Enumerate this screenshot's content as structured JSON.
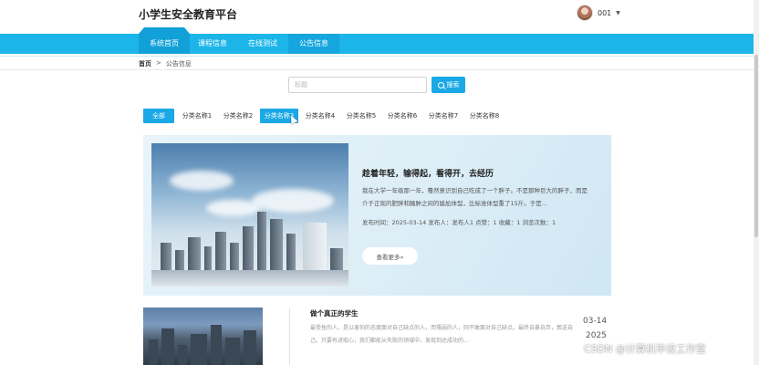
{
  "header": {
    "site_title": "小学生安全教育平台",
    "username": "001",
    "avatar_icon": "user-avatar",
    "caret_icon": "caret-down-icon"
  },
  "nav": {
    "items": [
      {
        "label": "系统首页",
        "state": "active"
      },
      {
        "label": "课程信息",
        "state": "normal"
      },
      {
        "label": "在线测试",
        "state": "normal"
      },
      {
        "label": "公告信息",
        "state": "selected"
      }
    ]
  },
  "breadcrumb": {
    "home": "首页",
    "separator": ">",
    "current": "公告信息"
  },
  "search": {
    "placeholder": "标题",
    "value": "",
    "button_label": "搜索",
    "icon": "search-icon"
  },
  "categories": {
    "items": [
      "全部",
      "分类名称1",
      "分类名称2",
      "分类名称3",
      "分类名称4",
      "分类名称5",
      "分类名称6",
      "分类名称7",
      "分类名称8"
    ],
    "selected": "全部",
    "hovered": "分类名称3"
  },
  "featured": {
    "title": "趁着年轻，输得起，看得开，去经历",
    "description": "我在大学一年级那一年，蓦然意识到自己吃成了一个胖子。不是那种巨大的胖子，而是介于正现的肥胖和臃肿之间的尴尬体型，比标准体型重了15斤。于是...",
    "meta": "发布时间：2025-03-14  发布人：发布人1  点赞：1  收藏：1  浏览次数：1",
    "more_label": "查看更多»"
  },
  "list": {
    "items": [
      {
        "title": "做个真正的学生",
        "description": "最受挫的人，是以害怕的态度面对自己缺点的人，而懦弱的人，则不敢面对自己缺点。最终自暴自弃，葬送自己。只要有进取心，我们都能从失败的领域中，发现到达成功的...",
        "date_md": "03-14",
        "date_year": "2025"
      }
    ]
  },
  "watermark": "CSDN @计算机毕设工作室",
  "colors": {
    "primary": "#1ba8e6",
    "nav_bg": "#1bb5ea",
    "nav_active": "#12a0d8",
    "hero_bg": "#e3f1f8"
  }
}
